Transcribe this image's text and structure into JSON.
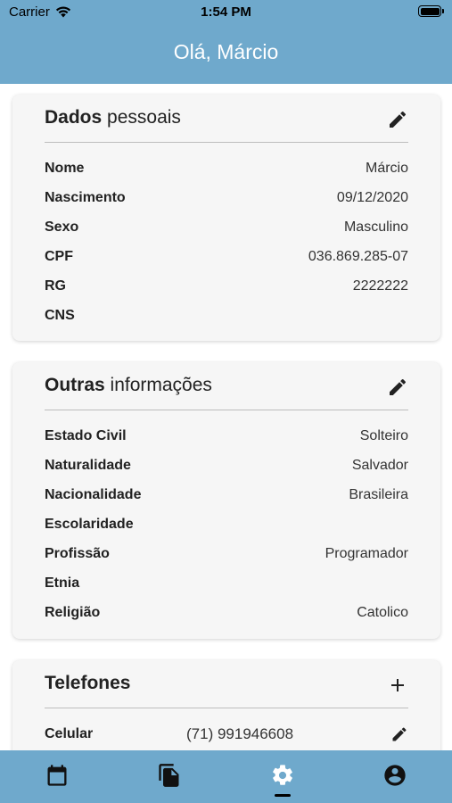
{
  "status_bar": {
    "carrier": "Carrier",
    "time": "1:54 PM"
  },
  "header": {
    "title": "Olá, Márcio"
  },
  "personal_card": {
    "title_bold": "Dados",
    "title_light": "pessoais",
    "action_icon": "pencil-icon",
    "rows": [
      {
        "label": "Nome",
        "value": "Márcio"
      },
      {
        "label": "Nascimento",
        "value": "09/12/2020"
      },
      {
        "label": "Sexo",
        "value": "Masculino"
      },
      {
        "label": "CPF",
        "value": "036.869.285-07"
      },
      {
        "label": "RG",
        "value": "2222222"
      },
      {
        "label": "CNS",
        "value": ""
      }
    ]
  },
  "other_card": {
    "title_bold": "Outras",
    "title_light": "informações",
    "action_icon": "pencil-icon",
    "rows": [
      {
        "label": "Estado Civil",
        "value": "Solteiro"
      },
      {
        "label": "Naturalidade",
        "value": "Salvador"
      },
      {
        "label": "Nacionalidade",
        "value": "Brasileira"
      },
      {
        "label": "Escolaridade",
        "value": ""
      },
      {
        "label": "Profissão",
        "value": "Programador"
      },
      {
        "label": "Etnia",
        "value": ""
      },
      {
        "label": "Religião",
        "value": "Catolico"
      }
    ]
  },
  "phones_card": {
    "title": "Telefones",
    "action_icon": "plus-icon",
    "rows": [
      {
        "label": "Celular",
        "value": "(71) 991946608",
        "action_icon": "pencil-icon"
      }
    ]
  },
  "bottom_nav": {
    "items": [
      "calendar-icon",
      "documents-icon",
      "settings-icon",
      "account-icon"
    ],
    "active": "settings-icon"
  },
  "colors": {
    "header": "#6fa9cc",
    "card": "#f6f6f6"
  }
}
